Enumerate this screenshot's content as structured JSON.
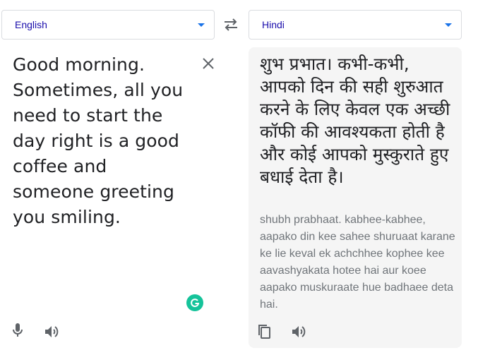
{
  "source_lang": {
    "label": "English",
    "icon": "chevron-down-icon"
  },
  "target_lang": {
    "label": "Hindi",
    "icon": "chevron-down-icon"
  },
  "swap": {
    "icon": "swap-arrows-icon"
  },
  "source": {
    "text": "Good morning. Sometimes, all you need to start the day right is a good coffee and someone greeting you smiling.",
    "clear_icon": "close-icon",
    "grammarly_icon": "grammarly-icon",
    "mic_icon": "microphone-icon",
    "speaker_icon": "speaker-icon"
  },
  "target": {
    "text": "शुभ प्रभात। कभी-कभी, आपको दिन की सही शुरुआत करने के लिए केवल एक अच्छी कॉफी की आवश्यकता होती है और कोई आपको मुस्कुराते हुए बधाई देता है।",
    "transliteration": "shubh prabhaat. kabhee-kabhee, aapako din kee sahee shuruaat karane ke lie keval ek achchhee kophee kee aavashyakata hotee hai aur koee aapako muskuraate hue badhaee deta hai.",
    "copy_icon": "copy-icon",
    "speaker_icon": "speaker-icon"
  },
  "colors": {
    "accent": "#1a73e8",
    "lang_text": "#1a0dab",
    "panel_bg": "#f5f5f5",
    "grammarly": "#15c39a"
  }
}
